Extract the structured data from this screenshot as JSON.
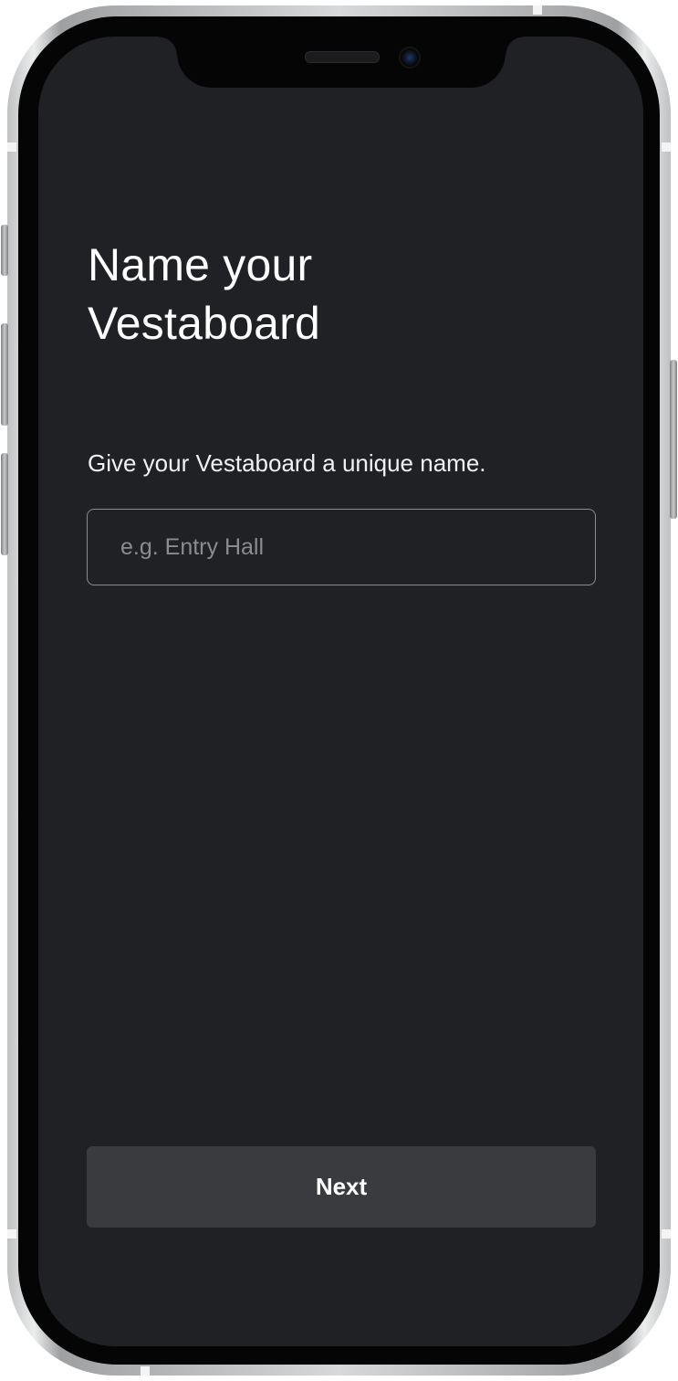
{
  "screen": {
    "title_line1": "Name your",
    "title_line2": "Vestaboard",
    "subtitle": "Give your Vestaboard a unique name.",
    "name_input": {
      "value": "",
      "placeholder": "e.g. Entry Hall"
    },
    "next_button": {
      "label": "Next"
    }
  },
  "colors": {
    "background": "#202124",
    "button_background": "#393b3e",
    "input_border": "#8b8c8e",
    "placeholder": "#8b8c8f",
    "text": "#ffffff"
  }
}
